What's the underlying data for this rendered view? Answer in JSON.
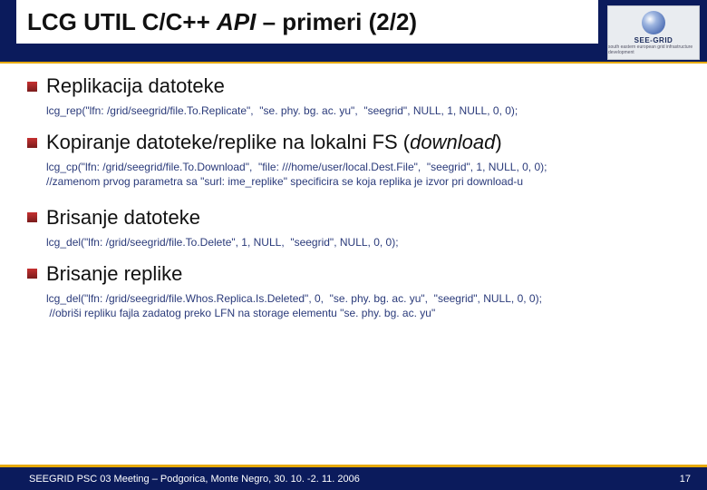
{
  "title_plain": "LCG UTIL C/C++ ",
  "title_ital": "API",
  "title_rest": " – primeri (2/2)",
  "logo": {
    "small": "SEE-GRID",
    "sub": "south eastern european grid infrastructure development"
  },
  "sections": [
    {
      "title": "Replikacija datoteke",
      "title_ital": "",
      "code": "lcg_rep(\"lfn: /grid/seegrid/file.To.Replicate\",  \"se. phy. bg. ac. yu\",  \"seegrid\", NULL, 1, NULL, 0, 0);"
    },
    {
      "title": "Kopiranje datoteke/replike na lokalni FS (",
      "title_ital": "download",
      "title_close": ")",
      "code": "lcg_cp(\"lfn: /grid/seegrid/file.To.Download\",  \"file: ///home/user/local.Dest.File\",  \"seegrid\", 1, NULL, 0, 0);\n//zamenom prvog parametra sa \"surl: ime_replike\" specificira se koja replika je izvor pri download-u"
    },
    {
      "title": "Brisanje datoteke",
      "title_ital": "",
      "code": "lcg_del(\"lfn: /grid/seegrid/file.To.Delete\", 1, NULL,  \"seegrid\", NULL, 0, 0);"
    },
    {
      "title": "Brisanje replike",
      "title_ital": "",
      "code": "lcg_del(\"lfn: /grid/seegrid/file.Whos.Replica.Is.Deleted\", 0,  \"se. phy. bg. ac. yu\",  \"seegrid\", NULL, 0, 0);\n //obriši repliku fajla zadatog preko LFN na storage elementu \"se. phy. bg. ac. yu\""
    }
  ],
  "footer": {
    "text": "SEEGRID PSC 03 Meeting – Podgorica, Monte Negro, 30. 10. -2. 11. 2006",
    "page": "17"
  }
}
